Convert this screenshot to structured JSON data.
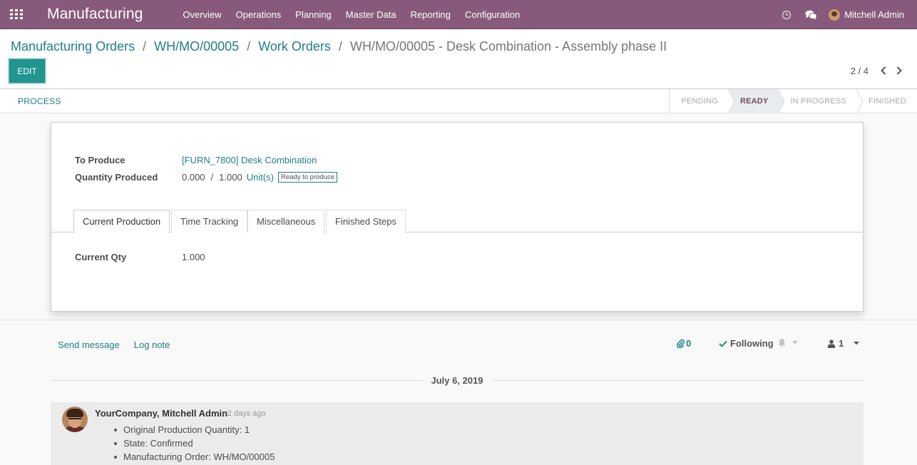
{
  "navbar": {
    "brand": "Manufacturing",
    "menu": [
      "Overview",
      "Operations",
      "Planning",
      "Master Data",
      "Reporting",
      "Configuration"
    ],
    "user_name": "Mitchell Admin"
  },
  "control_panel": {
    "breadcrumb": [
      "Manufacturing Orders",
      "WH/MO/00005",
      "Work Orders"
    ],
    "breadcrumb_active": "WH/MO/00005 - Desk Combination - Assembly phase II",
    "breadcrumb_separator": "/",
    "edit_label": "EDIT",
    "pager_value": "2 / 4"
  },
  "statusbar": {
    "process_label": "PROCESS",
    "stages": [
      "PENDING",
      "READY",
      "IN PROGRESS",
      "FINISHED"
    ],
    "active_stage": "READY"
  },
  "form": {
    "to_produce_label": "To Produce",
    "to_produce_value": "[FURN_7800] Desk Combination",
    "qty_produced_label": "Quantity Produced",
    "qty_produced": "0.000",
    "qty_separator": "/",
    "qty_total": "1.000",
    "uom": "Unit(s)",
    "badge": "Ready to produce",
    "tabs": [
      "Current Production",
      "Time Tracking",
      "Miscellaneous",
      "Finished Steps"
    ],
    "current_qty_label": "Current Qty",
    "current_qty_value": "1.000"
  },
  "chatter": {
    "send_message": "Send message",
    "log_note": "Log note",
    "attachments_count": "0",
    "following_label": "Following",
    "followers_count": "1",
    "date_separator": "July 6, 2019",
    "message": {
      "author": "YourCompany, Mitchell Admin",
      "time": "- 2 days ago",
      "items": [
        "Original Production Quantity: 1",
        "State: Confirmed",
        "Manufacturing Order: WH/MO/00005"
      ]
    }
  },
  "colors": {
    "navbar": "#875a7b",
    "accent": "#21968f",
    "link": "#1f7f86"
  }
}
